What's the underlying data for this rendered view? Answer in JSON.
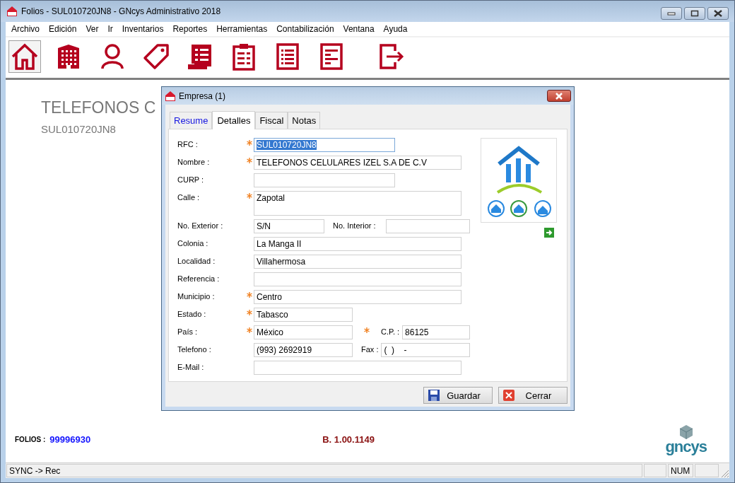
{
  "window": {
    "title": "Folios - SUL010720JN8 - GNcys Administrativo 2018"
  },
  "menu": [
    "Archivo",
    "Edición",
    "Ver",
    "Ir",
    "Inventarios",
    "Reportes",
    "Herramientas",
    "Contabilización",
    "Ventana",
    "Ayuda"
  ],
  "toolbar": [
    {
      "kind": "home",
      "selected": true
    },
    {
      "kind": "building",
      "selected": false
    },
    {
      "kind": "person",
      "selected": false
    },
    {
      "kind": "tag",
      "selected": false
    },
    {
      "kind": "scroll",
      "selected": false
    },
    {
      "kind": "clipboard",
      "selected": false
    },
    {
      "kind": "list",
      "selected": false
    },
    {
      "kind": "document",
      "selected": false
    },
    {
      "kind": "exit",
      "selected": false
    }
  ],
  "heading": "TELEFONOS C",
  "subheading": "SUL010720JN8",
  "footer": {
    "folios_label": "FOLIOS :",
    "folios_value": "99996930",
    "build": "B. 1.00.1149",
    "logo": "gncys"
  },
  "status_bar": {
    "text": "SYNC -> Rec",
    "num": "NUM"
  },
  "dialog": {
    "title": "Empresa (1)",
    "tabs": [
      {
        "label": "Resume",
        "selected": false
      },
      {
        "label": "Detalles",
        "selected": true
      },
      {
        "label": "Fiscal",
        "selected": false
      },
      {
        "label": "Notas",
        "selected": false
      }
    ],
    "rows": [
      {
        "label": "RFC :",
        "required": true,
        "value": "SUL010720JN8",
        "highlighted": true
      },
      {
        "label": "Nombre :",
        "required": true,
        "value": "TELEFONOS CELULARES IZEL S.A DE C.V",
        "highlighted": false
      },
      {
        "label": "CURP :",
        "required": false,
        "highlighted": false
      },
      {
        "label": "Calle :",
        "required": true,
        "value": "Zapotal",
        "highlighted": false
      },
      {
        "label": "No. Exterior :",
        "required": false,
        "value": "S/N",
        "highlighted": false,
        "second": {
          "label": "No. Interior :",
          "required": false
        }
      },
      {
        "label": "Colonia :",
        "required": false,
        "value": "La Manga II",
        "highlighted": false
      },
      {
        "label": "Localidad :",
        "required": false,
        "value": "Villahermosa",
        "highlighted": false
      },
      {
        "label": "Referencia :",
        "required": false,
        "highlighted": false
      },
      {
        "label": "Municipio :",
        "required": true,
        "value": "Centro",
        "highlighted": false
      },
      {
        "label": "Estado :",
        "required": true,
        "value": "Tabasco",
        "highlighted": false
      },
      {
        "label": "País :",
        "required": true,
        "value": "México",
        "highlighted": false,
        "second": {
          "label": "C.P. :",
          "required": true,
          "value": "86125"
        }
      },
      {
        "label": "Telefono :",
        "required": false,
        "value": "(993) 2692919",
        "highlighted": false,
        "second": {
          "label": "Fax :",
          "required": false,
          "value": "(  )    -"
        }
      },
      {
        "label": "E-Mail :",
        "required": false,
        "highlighted": false
      }
    ],
    "buttons": [
      {
        "label": "Guardar",
        "kind": "save"
      },
      {
        "label": "Cerrar",
        "kind": "close"
      }
    ]
  }
}
